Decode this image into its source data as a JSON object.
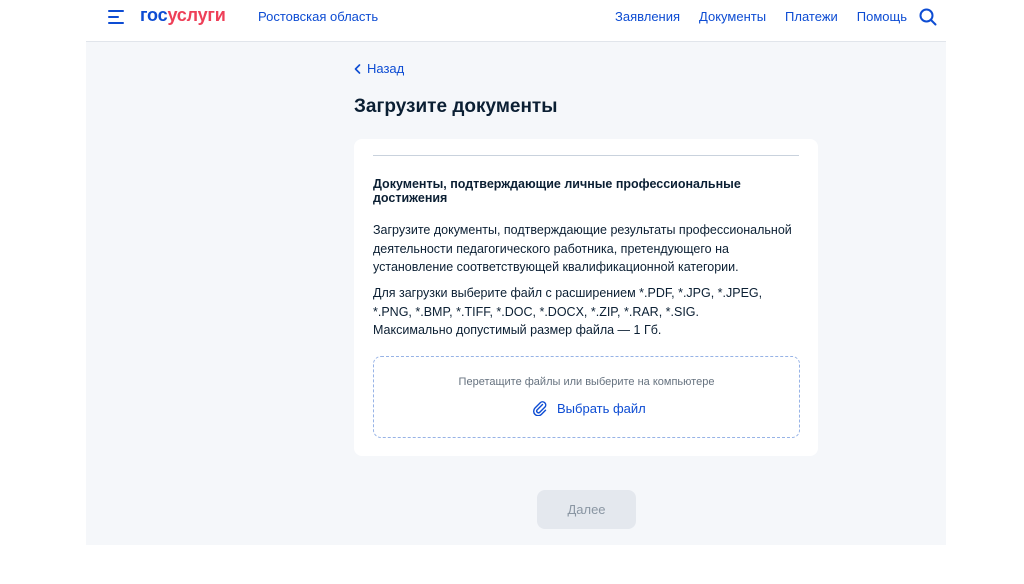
{
  "header": {
    "logo_part1": "гос",
    "logo_part2": "услуги",
    "region": "Ростовская область",
    "nav": [
      "Заявления",
      "Документы",
      "Платежи",
      "Помощь"
    ],
    "icons": {
      "menu": "burger-menu-icon",
      "search": "search-icon"
    }
  },
  "back_label": "Назад",
  "page_title": "Загрузите документы",
  "card": {
    "subtitle": "Документы, подтверждающие личные профессиональные достижения",
    "description": "Загрузите документы, подтверждающие результаты профессиональной деятельности педагогического работника, претендующего на установление соответствующей квалификационной категории.",
    "formats_line1": "Для загрузки выберите файл с расширением *.PDF, *.JPG, *.JPEG, *.PNG, *.BMP, *.TIFF, *.DOC, *.DOCX, *.ZIP, *.RAR, *.SIG.",
    "formats_line2": "Максимально допустимый размер файла — 1 Гб.",
    "dropzone_hint": "Перетащите файлы или выберите на компьютере",
    "pick_file_label": "Выбрать файл"
  },
  "next_button": "Далее",
  "colors": {
    "brand_blue": "#0d4cd3",
    "brand_red": "#ee3f58",
    "background": "#f5f7fa",
    "disabled_button": "#e4e8ee"
  }
}
